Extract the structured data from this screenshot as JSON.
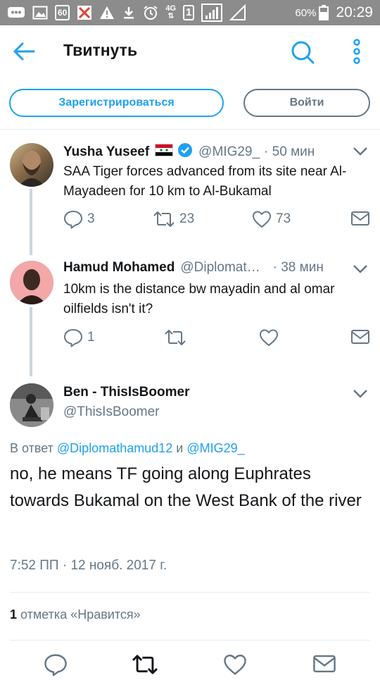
{
  "statusbar": {
    "badge": "60",
    "network": "4G",
    "sim": "1",
    "battery": "60%",
    "time": "20:29"
  },
  "appbar": {
    "title": "Твитнуть"
  },
  "auth": {
    "signup_label": "Зарегистрироваться",
    "login_label": "Войти"
  },
  "tweets": [
    {
      "name": "Yusha Yuseef",
      "handle": "@MIG29_",
      "time": "· 50 мин",
      "text": "SAA Tiger forces advanced from its site near Al-Mayadeen for 10 km to Al-Bukamal",
      "replies": "3",
      "retweets": "23",
      "likes": "73"
    },
    {
      "name": "Hamud Mohamed",
      "handle": "@Diplomat…",
      "time": "· 38 мин",
      "text": "10km is the distance bw mayadin and al omar oilfields isn't it?",
      "replies": "1",
      "retweets": "",
      "likes": ""
    }
  ],
  "main_tweet": {
    "name": "Ben - ThisIsBoomer",
    "handle": "@ThisIsBoomer",
    "reply_prefix": "В ответ",
    "reply_user1": "@Diplomathamud12",
    "reply_and": "и",
    "reply_user2": "@MIG29_",
    "text": "no, he means TF going along Euphrates towards Bukamal on the West Bank of the river",
    "timestamp": "7:52 ПП · 12 нояб. 2017 г.",
    "likes_count": "1",
    "likes_label": "отметка «Нравится»"
  },
  "colors": {
    "accent": "#1da1f2",
    "muted": "#657786",
    "text": "#14171a",
    "statusbar": "#8c8c8c"
  },
  "icons": [
    "back-arrow-icon",
    "search-icon",
    "more-vertical-icon",
    "chevron-down-icon",
    "reply-icon",
    "retweet-icon",
    "heart-icon",
    "message-icon",
    "verified-icon",
    "flag-icon"
  ]
}
